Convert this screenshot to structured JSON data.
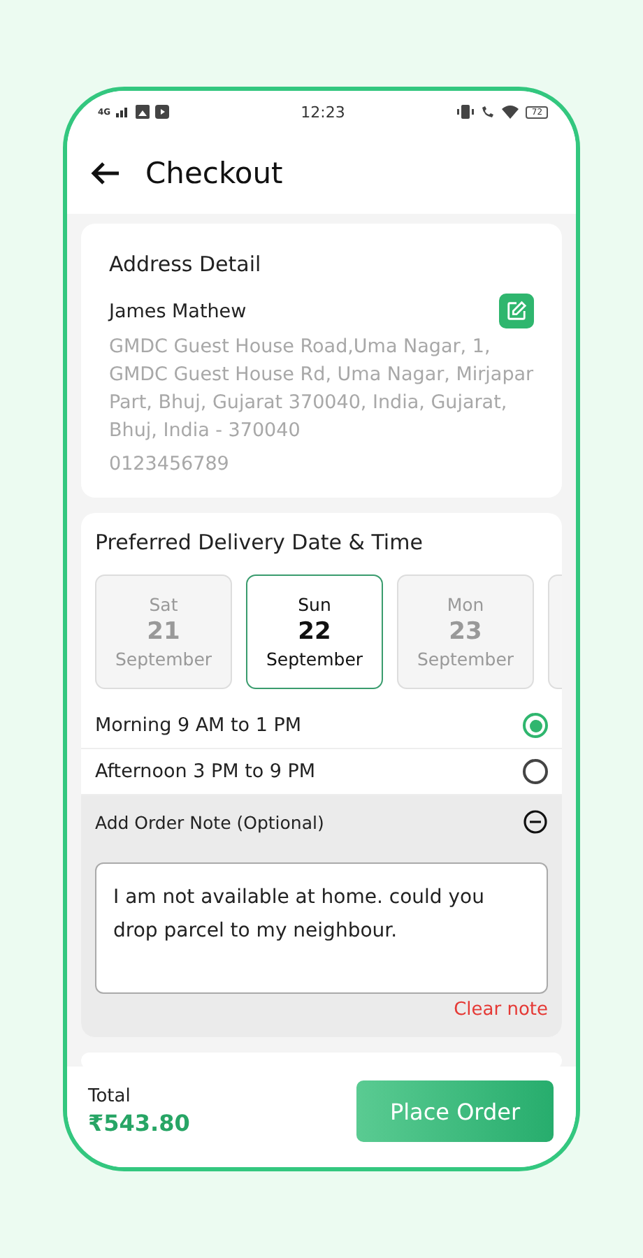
{
  "status_bar": {
    "network": "4G",
    "time": "12:23",
    "battery": "72"
  },
  "header": {
    "title": "Checkout"
  },
  "address": {
    "title": "Address Detail",
    "name": "James Mathew",
    "lines": "GMDC Guest House Road,Uma Nagar, 1, GMDC Guest House Rd, Uma Nagar, Mirjapar Part, Bhuj, Gujarat 370040, India, Gujarat, Bhuj, India - 370040",
    "phone": "0123456789"
  },
  "delivery": {
    "title": "Preferred Delivery Date & Time",
    "dates": [
      {
        "day": "Sat",
        "date": "21",
        "month": "September",
        "selected": false
      },
      {
        "day": "Sun",
        "date": "22",
        "month": "September",
        "selected": true
      },
      {
        "day": "Mon",
        "date": "23",
        "month": "September",
        "selected": false
      }
    ],
    "slots": [
      {
        "label": "Morning 9 AM to 1 PM",
        "selected": true
      },
      {
        "label": "Afternoon 3 PM to 9 PM",
        "selected": false
      }
    ]
  },
  "note": {
    "title": "Add Order Note (Optional)",
    "expanded": true,
    "value": "I am not available at home. could you drop parcel to my neighbour.",
    "clear": "Clear note"
  },
  "footer": {
    "total_label": "Total",
    "total": "₹543.80",
    "button": "Place Order"
  }
}
